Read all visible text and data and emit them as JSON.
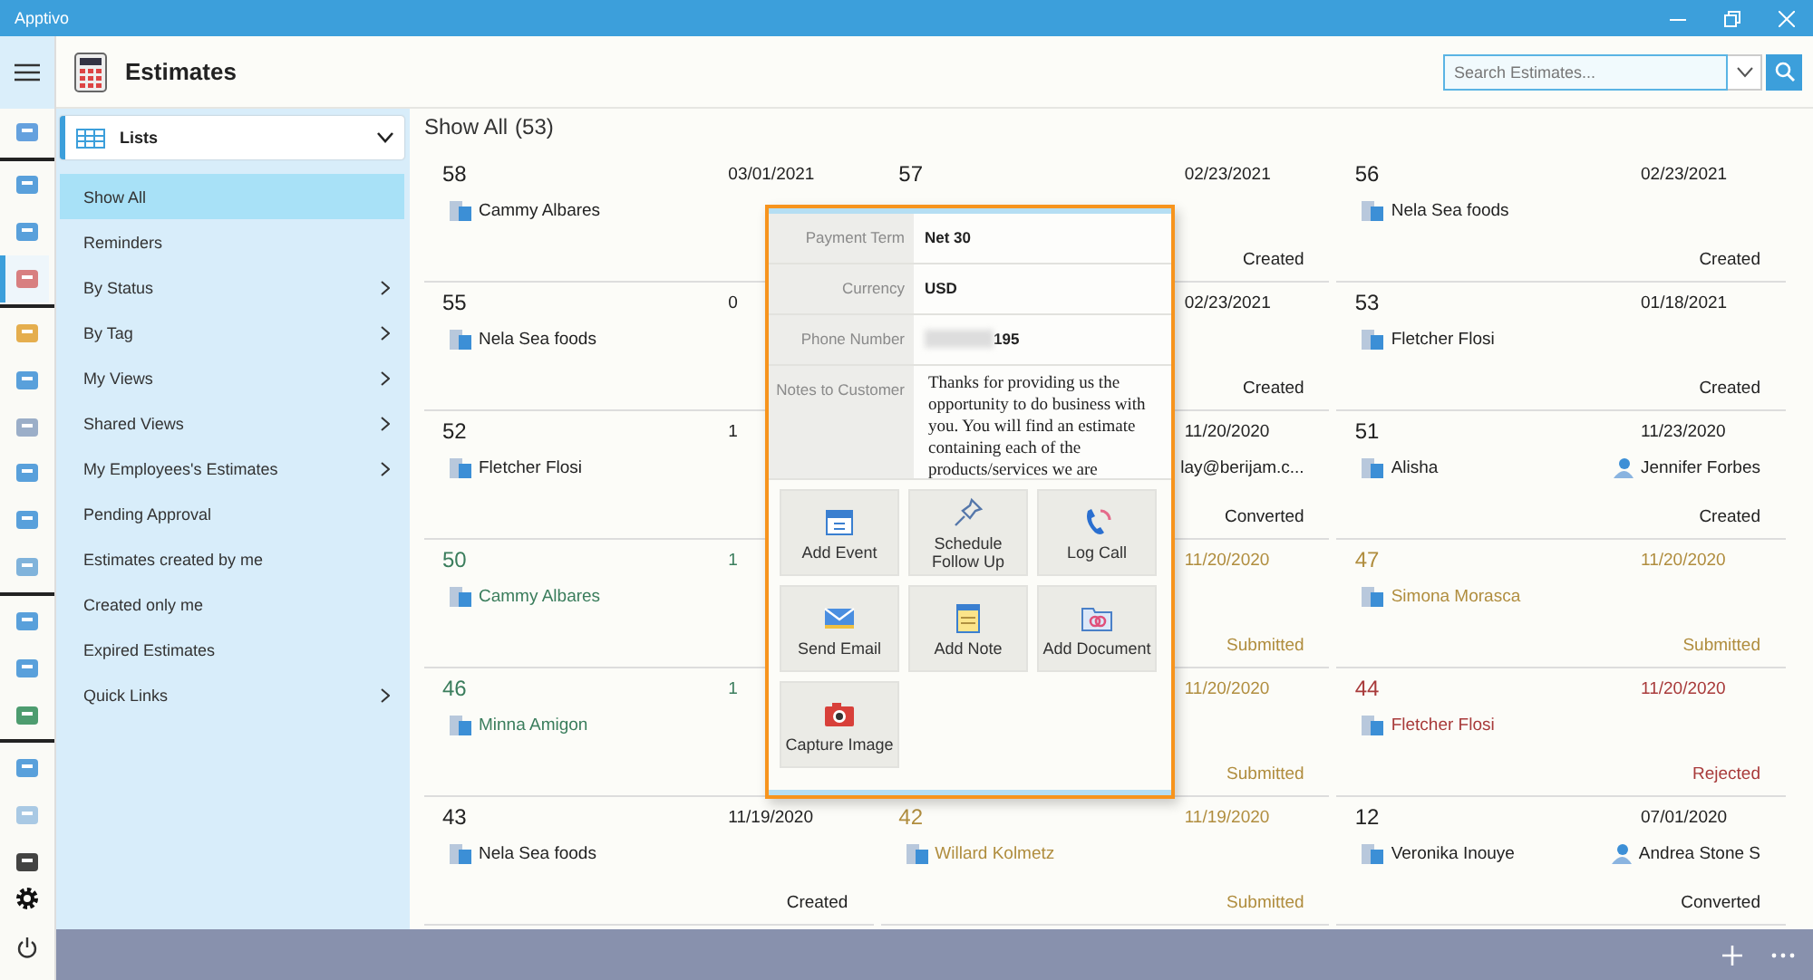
{
  "window": {
    "title": "Apptivo"
  },
  "rail_icons": [
    {
      "selected": false
    },
    {
      "selected": false
    },
    {
      "selected": false
    },
    {
      "selected": true
    },
    {
      "selected": false
    },
    {
      "selected": false
    },
    {
      "selected": false
    },
    {
      "selected": false
    },
    {
      "selected": false
    },
    {
      "selected": false
    },
    {
      "selected": false
    },
    {
      "selected": false
    },
    {
      "selected": false
    },
    {
      "selected": false
    },
    {
      "selected": false
    },
    {
      "selected": false
    }
  ],
  "header": {
    "title": "Estimates",
    "search": {
      "placeholder": "Search Estimates..."
    }
  },
  "sidebar": {
    "dropdown": "Lists",
    "items": [
      {
        "label": "Show All",
        "kind": "link",
        "selected": true
      },
      {
        "label": "Reminders",
        "kind": "link",
        "selected": false
      },
      {
        "label": "By Status",
        "kind": "folder",
        "selected": false
      },
      {
        "label": "By Tag",
        "kind": "folder",
        "selected": false
      },
      {
        "label": "My Views",
        "kind": "folder",
        "selected": false
      },
      {
        "label": "Shared Views",
        "kind": "folder",
        "selected": false
      },
      {
        "label": "My Employees's Estimates",
        "kind": "folder",
        "selected": false
      },
      {
        "label": "Pending Approval",
        "kind": "link",
        "selected": false
      },
      {
        "label": "Estimates created by me",
        "kind": "link",
        "selected": false
      },
      {
        "label": "Created only me",
        "kind": "link",
        "selected": false
      },
      {
        "label": "Expired Estimates",
        "kind": "link",
        "selected": false
      },
      {
        "label": "Quick Links",
        "kind": "folder",
        "selected": false
      }
    ]
  },
  "list": {
    "title": "Show All",
    "count": "(53)",
    "columns": [
      [
        {
          "number": "58",
          "date": "03/01/2021",
          "customer": "Cammy Albares",
          "color": "#222222"
        },
        {
          "number": "55",
          "date": "0",
          "customer": "Nela Sea foods",
          "color": "#222222"
        },
        {
          "number": "52",
          "date": "1",
          "customer": "Fletcher Flosi",
          "color": "#222222"
        },
        {
          "number": "50",
          "date": "1",
          "customer": "Cammy Albares",
          "color": "#3a7d5c"
        },
        {
          "number": "46",
          "date": "1",
          "customer": "Minna Amigon",
          "color": "#3a7d5c"
        },
        {
          "number": "43",
          "date": "11/19/2020",
          "customer": "Nela Sea foods",
          "status": "Created",
          "color": "#222222"
        }
      ],
      [
        {
          "number": "57",
          "date": "02/23/2021",
          "status": "Created",
          "color": "#222222"
        },
        {
          "date": "02/23/2021",
          "status": "Created",
          "color": "#222222"
        },
        {
          "date": "11/20/2020",
          "contact": {
            "name": "lay@berijam.c...",
            "icon": false
          },
          "status": "Converted",
          "color": "#222222"
        },
        {
          "date": "11/20/2020",
          "status": "Submitted",
          "color": "#b08d3e"
        },
        {
          "date": "11/20/2020",
          "status": "Submitted",
          "color": "#b08d3e"
        },
        {
          "number": "42",
          "date": "11/19/2020",
          "customer": "Willard Kolmetz",
          "status": "Submitted",
          "color": "#b08d3e"
        }
      ],
      [
        {
          "number": "56",
          "date": "02/23/2021",
          "customer": "Nela Sea foods",
          "status": "Created",
          "color": "#222222"
        },
        {
          "number": "53",
          "date": "01/18/2021",
          "customer": "Fletcher Flosi",
          "status": "Created",
          "color": "#222222"
        },
        {
          "number": "51",
          "date": "11/23/2020",
          "customer": "Alisha",
          "contact": {
            "name": "Jennifer Forbes",
            "icon": true
          },
          "status": "Created",
          "color": "#222222"
        },
        {
          "number": "47",
          "date": "11/20/2020",
          "customer": "Simona Morasca",
          "status": "Submitted",
          "color": "#b08d3e"
        },
        {
          "number": "44",
          "date": "11/20/2020",
          "customer": "Fletcher Flosi",
          "status": "Rejected",
          "color": "#a83a3a"
        },
        {
          "number": "12",
          "date": "07/01/2020",
          "customer": "Veronika Inouye",
          "contact": {
            "name": "Andrea Stone S",
            "icon": true
          },
          "status": "Converted",
          "color": "#222222"
        }
      ]
    ]
  },
  "popup": {
    "details": [
      {
        "label": "Payment Term",
        "value": "Net 30",
        "kind": "text"
      },
      {
        "label": "Currency",
        "value": "USD",
        "kind": "text"
      },
      {
        "label": "Phone Number",
        "value": "195",
        "kind": "redacted"
      },
      {
        "label": "Notes to Customer",
        "value": "Thanks for providing us the opportunity to do business with you. You will find an estimate containing each of the products/services we are",
        "kind": "notes"
      }
    ],
    "actions": [
      {
        "label": "Add Event",
        "kind": "calendar"
      },
      {
        "label": "Schedule Follow Up",
        "kind": "pin"
      },
      {
        "label": "Log Call",
        "kind": "phone"
      },
      {
        "label": "Send Email",
        "kind": "mail"
      },
      {
        "label": "Add Note",
        "kind": "note"
      },
      {
        "label": "Add Document",
        "kind": "folder"
      },
      {
        "label": "Capture Image",
        "kind": "camera"
      }
    ]
  }
}
